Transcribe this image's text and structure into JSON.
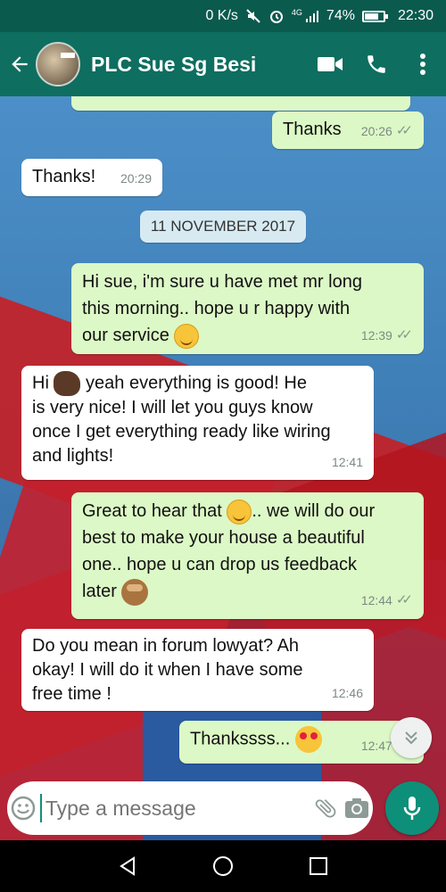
{
  "status_bar": {
    "speed": "0 K/s",
    "network": "4G",
    "battery": "74%",
    "time": "22:30"
  },
  "header": {
    "contact_name": "PLC Sue Sg Besi",
    "icons": [
      "back-arrow-icon",
      "video-call-icon",
      "phone-icon",
      "more-vert-icon"
    ]
  },
  "chat": {
    "date_divider": "11 NOVEMBER 2017",
    "messages": [
      {
        "dir": "out",
        "text": "Thanks",
        "time": "20:26"
      },
      {
        "dir": "in",
        "text": "Thanks!",
        "time": "20:29"
      },
      {
        "dir": "out",
        "lines": [
          "Hi sue, i'm sure u have met mr long",
          "this morning.. hope u r happy with",
          "our service"
        ],
        "time": "12:39"
      },
      {
        "dir": "in",
        "lines": [
          "Hi",
          "yeah everything is good! He",
          "is very nice! I will let you guys know",
          "once I get everything ready like wiring",
          "and lights!"
        ],
        "time": "12:41"
      },
      {
        "dir": "out",
        "lines": [
          "Great to hear that",
          ".. we will do our",
          "best to make your house a beautiful",
          "one.. hope u can drop us feedback",
          "later"
        ],
        "time": "12:44"
      },
      {
        "dir": "in",
        "lines": [
          "Do you mean in forum lowyat? Ah",
          "okay! I will do it when I have some",
          "free time !"
        ],
        "time": "12:46"
      },
      {
        "dir": "out",
        "text": "Thankssss...",
        "time": "12:47"
      }
    ]
  },
  "composer": {
    "placeholder": "Type a message"
  },
  "colors": {
    "header": "#0e6e60",
    "outgoing_bubble": "#dcf8c6",
    "incoming_bubble": "#ffffff",
    "accent": "#0e8f7a"
  }
}
